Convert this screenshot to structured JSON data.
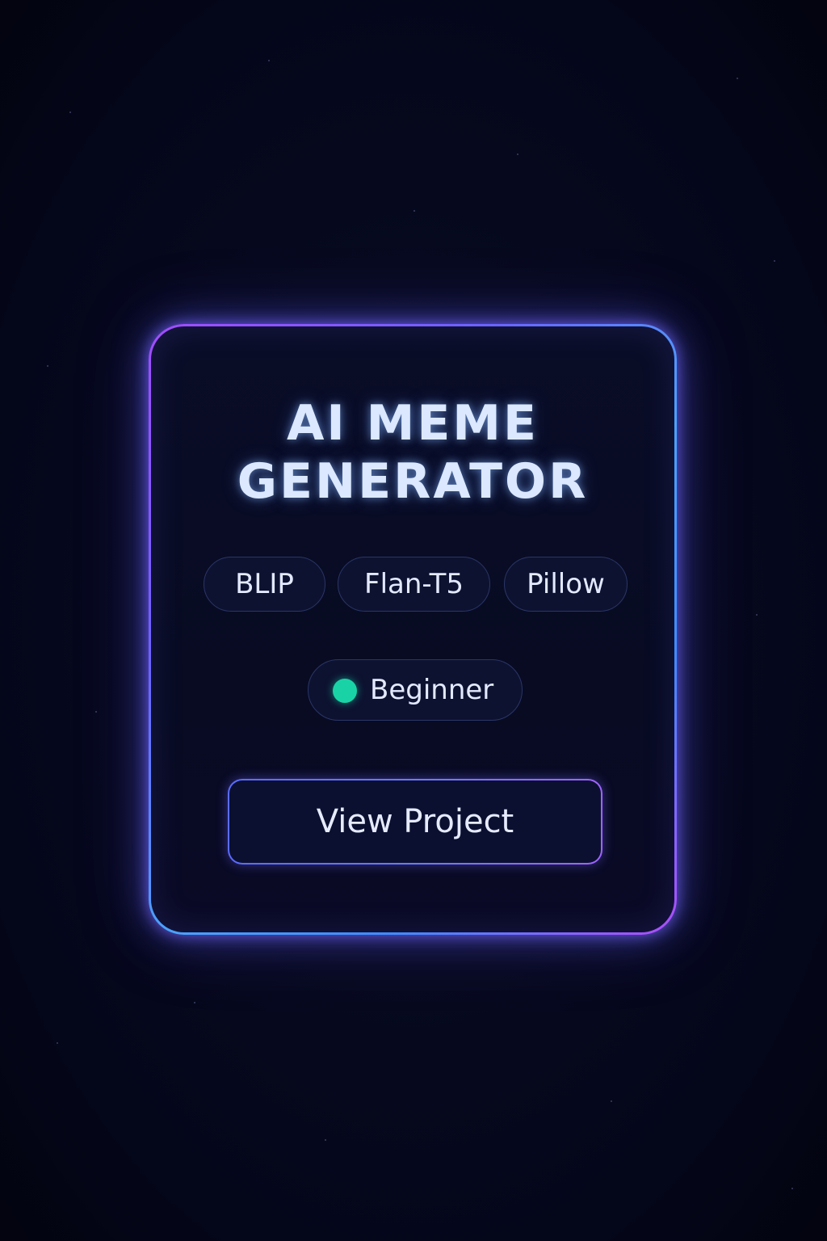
{
  "card": {
    "title_line1": "AI MEME",
    "title_line2": "GENERATOR",
    "tags": [
      "BLIP",
      "Flan-T5",
      "Pillow"
    ],
    "level": {
      "label": "Beginner",
      "dot_color": "#19d3a6"
    },
    "button_label": "View Project"
  },
  "colors": {
    "background": "#050716",
    "border_gradient": [
      "#a34cff",
      "#4aa3ff",
      "#b04cff"
    ],
    "title": "#dbe8ff",
    "accent_green": "#19d3a6"
  }
}
